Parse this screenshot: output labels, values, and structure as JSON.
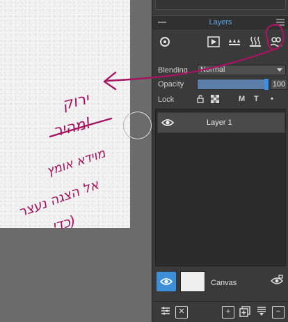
{
  "panel": {
    "title": "Layers",
    "properties": {
      "blending_label": "Blending",
      "blending_value": "Normal",
      "opacity_label": "Opacity",
      "opacity_value": "100",
      "lock_label": "Lock",
      "lock_m": "M",
      "lock_t": "T"
    },
    "layers": [
      {
        "name": "Layer 1"
      }
    ],
    "canvas_layer": {
      "name": "Canvas"
    }
  },
  "annotation": {
    "lines": [
      "ירוק",
      "מהיר!",
      "מוידא אומץ",
      "אל הצגה נעצר",
      "כדי)"
    ],
    "color": "#a3165f"
  },
  "colors": {
    "accent": "#3d8fd8",
    "title": "#5aa2e6",
    "panel_bg": "#3a3a3a"
  },
  "icons": [
    "target-icon",
    "play-icon",
    "drops-icon",
    "steam-icon",
    "water-alga-icon",
    "eye-icon",
    "lock-open-icon",
    "checker-icon",
    "dot-icon",
    "settings-icon",
    "close-icon",
    "add-icon",
    "duplicate-icon",
    "merge-icon",
    "remove-icon",
    "camera-eye-icon"
  ]
}
